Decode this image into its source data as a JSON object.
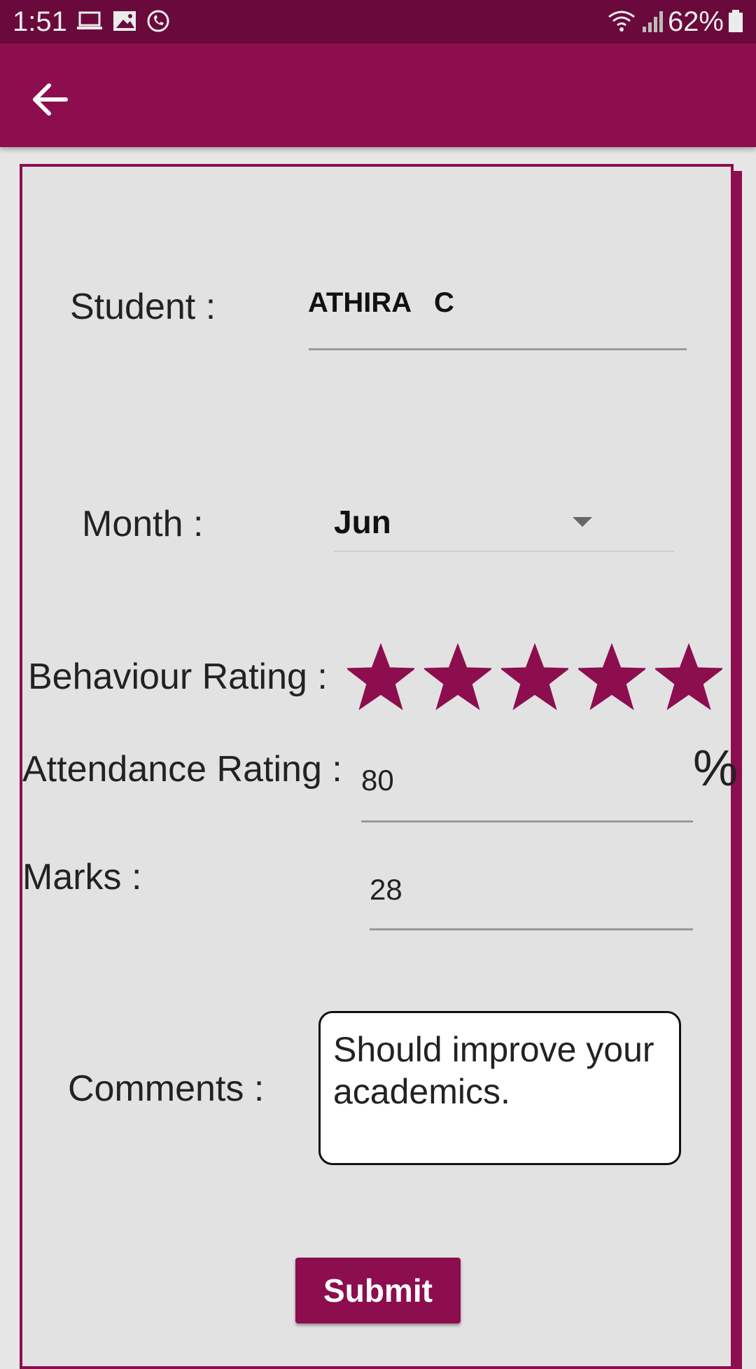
{
  "status_bar": {
    "time": "1:51",
    "battery_percent": "62%",
    "icons": [
      "laptop-icon",
      "image-icon",
      "whatsapp-icon",
      "wifi-icon",
      "signal-icon",
      "battery-icon"
    ]
  },
  "app_bar": {
    "back_icon": "arrow-left-icon"
  },
  "form": {
    "student": {
      "label": "Student :",
      "value": "ATHIRA   C"
    },
    "month": {
      "label": "Month :",
      "value": "Jun"
    },
    "behaviour": {
      "label": "Behaviour Rating :",
      "rating": 5,
      "max": 5
    },
    "attendance": {
      "label": "Attendance Rating :",
      "value": "80",
      "suffix": "%"
    },
    "marks": {
      "label": "Marks :",
      "value": "28"
    },
    "comments": {
      "label": "Comments :",
      "value": "Should improve your academics."
    },
    "submit_label": "Submit"
  },
  "colors": {
    "primary": "#8c0e4e",
    "status_bar": "#6a0a3c",
    "background": "#e2e2e2"
  }
}
